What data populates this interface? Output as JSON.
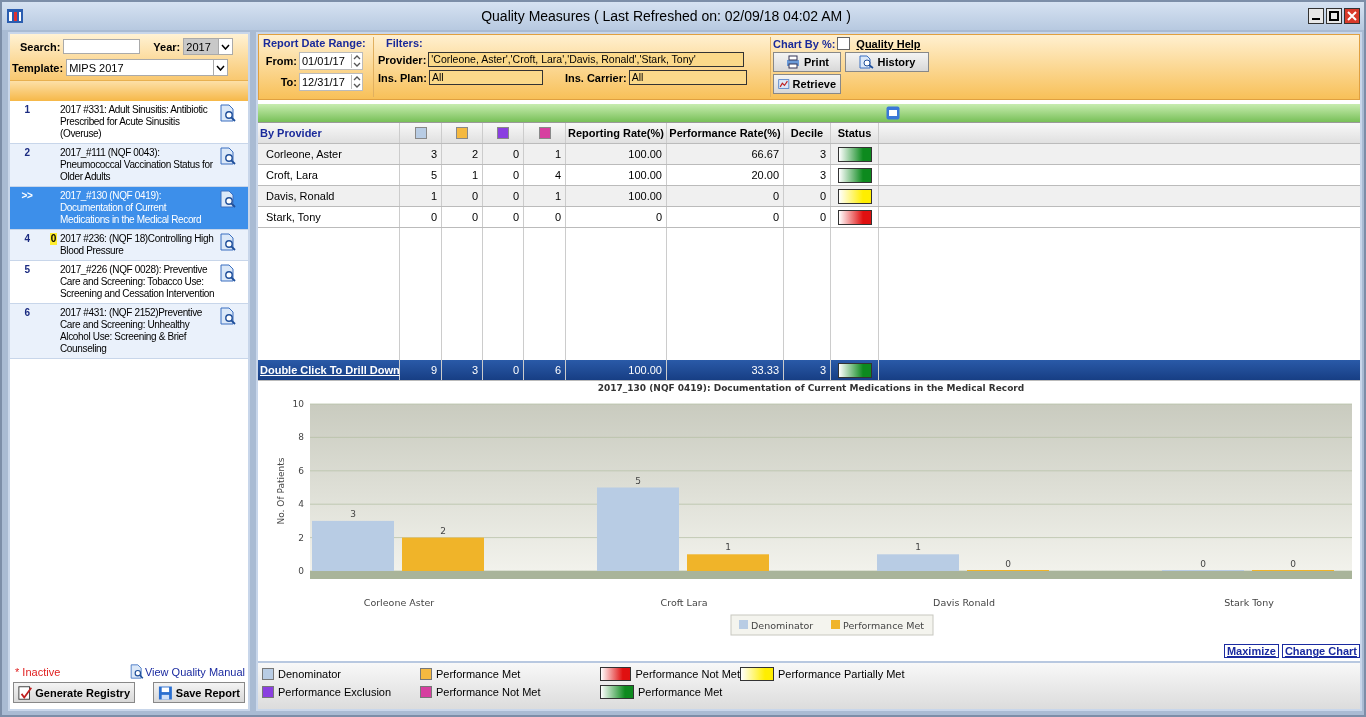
{
  "window": {
    "title": "Quality Measures ( Last Refreshed on: 02/09/18 04:02 AM )"
  },
  "left_panel": {
    "search": {
      "label": "Search:"
    },
    "year": {
      "label": "Year:",
      "value": "2017"
    },
    "template": {
      "label": "Template:",
      "value": "MIPS 2017"
    },
    "measures": [
      {
        "number": "1",
        "text": "2017 #331: Adult Sinusitis: Antibiotic Prescribed for Acute Sinusitis (Overuse)",
        "selected": false
      },
      {
        "number": "2",
        "text": "2017_#111 (NQF 0043): Pneumococcal Vaccination Status for Older Adults",
        "selected": false
      },
      {
        "number": ">>",
        "text": "2017_#130 (NQF 0419): Documentation of Current Medications in the Medical Record",
        "selected": true
      },
      {
        "number": "4",
        "badge": "0",
        "text": "2017 #236: (NQF 18)Controlling High Blood Pressure",
        "selected": false
      },
      {
        "number": "5",
        "text": "2017_#226 (NQF 0028): Preventive Care and Screening: Tobacco Use: Screening and Cessation Intervention",
        "selected": false
      },
      {
        "number": "6",
        "text": "2017 #431: (NQF 2152)Preventive Care and Screening: Unhealthy Alcohol Use: Screening & Brief Counseling",
        "selected": false
      }
    ],
    "inactive_note": "* Inactive",
    "manual_link": "View Quality Manual",
    "buttons": [
      {
        "label": "Generate Registry",
        "kind": "registry"
      },
      {
        "label": "Save Report",
        "kind": "save"
      }
    ]
  },
  "filters": {
    "date_range_label": "Report Date Range:",
    "from": {
      "label": "From:",
      "value": "01/01/17"
    },
    "to": {
      "label": "To:",
      "value": "12/31/17"
    },
    "filters_label": "Filters:",
    "provider": {
      "label": "Provider:",
      "value": "'Corleone, Aster','Croft, Lara','Davis, Ronald','Stark, Tony'"
    },
    "ins_plan": {
      "label": "Ins. Plan:",
      "value": "All"
    },
    "ins_carrier": {
      "label": "Ins. Carrier:",
      "value": "All"
    },
    "chart_by": {
      "label": "Chart By %:",
      "checked": false
    },
    "quality_help": "Quality Help",
    "buttons": [
      {
        "label": "Print",
        "kind": "print"
      },
      {
        "label": "History",
        "kind": "history"
      },
      {
        "label": "Retrieve",
        "kind": "retrieve"
      }
    ]
  },
  "table": {
    "columns": [
      {
        "label": "By Provider"
      },
      {
        "color": "#b8cce4"
      },
      {
        "color": "#f5b940"
      },
      {
        "color": "#8a3fe0"
      },
      {
        "color": "#d63fa0"
      },
      {
        "label": "Reporting Rate(%)"
      },
      {
        "label": "Performance Rate(%)"
      },
      {
        "label": "Decile"
      },
      {
        "label": "Status"
      }
    ],
    "rows": [
      {
        "cells": [
          "Corleone, Aster",
          "3",
          "2",
          "0",
          "1",
          "100.00",
          "66.67",
          "3"
        ],
        "color": "#0d8a1e"
      },
      {
        "cells": [
          "Croft, Lara",
          "5",
          "1",
          "0",
          "4",
          "100.00",
          "20.00",
          "3"
        ],
        "color": "#0d8a1e"
      },
      {
        "cells": [
          "Davis, Ronald",
          "1",
          "0",
          "0",
          "1",
          "100.00",
          "0",
          "0"
        ],
        "color": "#ffee00"
      },
      {
        "cells": [
          "Stark, Tony",
          "0",
          "0",
          "0",
          "0",
          "0",
          "0",
          "0"
        ],
        "color": "#e01010"
      }
    ],
    "total": {
      "cells": [
        "Double Click To Drill Down",
        "9",
        "3",
        "0",
        "6",
        "100.00",
        "33.33",
        "3"
      ],
      "color": "#0d8a1e"
    }
  },
  "chart": {
    "chart_data": {
      "type": "bar",
      "title": "2017_130 (NQF 0419): Documentation of Current Medications in the Medical Record",
      "ylabel": "No. Of Patients",
      "categories": [
        "Corleone  Aster",
        "Croft  Lara",
        "Davis  Ronald",
        "Stark  Tony"
      ],
      "series": [
        {
          "name": "Denominator",
          "color": "#b8cce4",
          "values": [
            3,
            5,
            1,
            0
          ]
        },
        {
          "name": "Performance Met",
          "color": "#f0b429",
          "values": [
            2,
            1,
            0,
            0
          ]
        }
      ],
      "ylim": [
        0,
        10
      ],
      "yticks": [
        0,
        2,
        4,
        6,
        8,
        10
      ],
      "grid": true,
      "legend": "bottom",
      "data_labels": true
    },
    "links": [
      "Maximize",
      "Change Chart"
    ]
  },
  "legend": [
    {
      "label": "Denominator",
      "kind": "color",
      "color": "#b8cce4"
    },
    {
      "label": "Performance Met",
      "kind": "color",
      "color": "#f5b940"
    },
    {
      "label": "Performance Not Met",
      "kind": "gradient",
      "color": "#e01010"
    },
    {
      "label": "Performance Partially Met",
      "kind": "gradient",
      "color": "#ffee00"
    },
    {
      "label": "Performance Exclusion",
      "kind": "color",
      "color": "#8a3fe0"
    },
    {
      "label": "Performance Not Met",
      "kind": "color",
      "color": "#d63fa0"
    },
    {
      "label": "Performance Met",
      "kind": "gradient",
      "color": "#0d8a1e"
    }
  ]
}
